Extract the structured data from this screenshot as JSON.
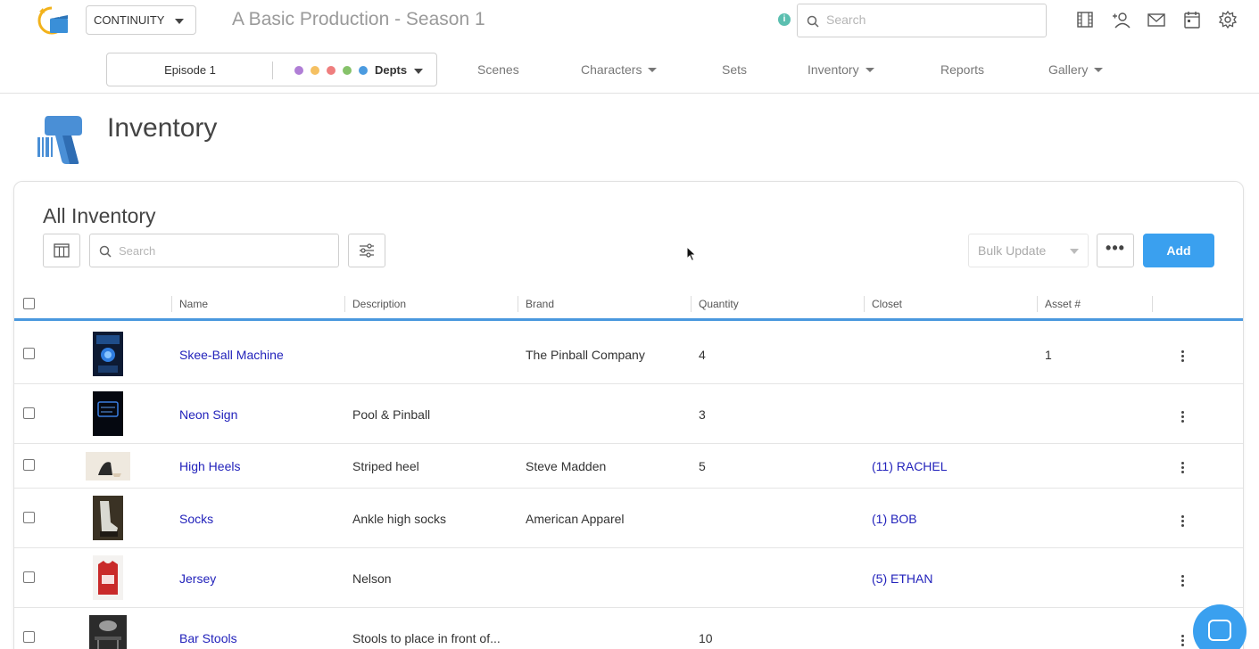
{
  "app": {
    "module_select": "CONTINUITY",
    "production_title": "A Basic Production - Season 1",
    "top_search_placeholder": "Search",
    "colors": {
      "accent": "#3aa0ef",
      "link": "#2222bb",
      "info": "#5bbfb0"
    }
  },
  "top_icons": [
    "film-icon",
    "add-user-icon",
    "mail-icon",
    "calendar-icon",
    "gear-icon"
  ],
  "subnav": {
    "episode": "Episode 1",
    "depts_label": "Depts",
    "dept_colors": [
      "#b07ed6",
      "#f5c062",
      "#ef7e7e",
      "#86c26a",
      "#4b9be0"
    ],
    "items": [
      {
        "label": "Scenes",
        "dropdown": false
      },
      {
        "label": "Characters",
        "dropdown": true
      },
      {
        "label": "Sets",
        "dropdown": false
      },
      {
        "label": "Inventory",
        "dropdown": true
      },
      {
        "label": "Reports",
        "dropdown": false
      },
      {
        "label": "Gallery",
        "dropdown": true
      }
    ]
  },
  "page": {
    "title": "Inventory"
  },
  "card": {
    "title": "All Inventory",
    "search_placeholder": "Search",
    "bulk_update_label": "Bulk Update",
    "more_label": "•••",
    "add_label": "Add"
  },
  "table": {
    "columns": [
      "Name",
      "Description",
      "Brand",
      "Quantity",
      "Closet",
      "Asset #"
    ],
    "rows": [
      {
        "name": "Skee-Ball Machine",
        "description": "",
        "brand": "The Pinball Company",
        "quantity": "4",
        "closet": "",
        "asset": "1",
        "thumb": "skee-ball"
      },
      {
        "name": "Neon Sign",
        "description": "Pool & Pinball",
        "brand": "",
        "quantity": "3",
        "closet": "",
        "asset": "",
        "thumb": "neon"
      },
      {
        "name": "High Heels",
        "description": "Striped heel",
        "brand": "Steve Madden",
        "quantity": "5",
        "closet": "(11) RACHEL",
        "asset": "",
        "thumb": "heels"
      },
      {
        "name": "Socks",
        "description": "Ankle high socks",
        "brand": "American Apparel",
        "quantity": "",
        "closet": "(1) BOB",
        "asset": "",
        "thumb": "socks"
      },
      {
        "name": "Jersey",
        "description": "Nelson",
        "brand": "",
        "quantity": "",
        "closet": "(5) ETHAN",
        "asset": "",
        "thumb": "jersey"
      },
      {
        "name": "Bar Stools",
        "description": "Stools to place in front of...",
        "brand": "",
        "quantity": "10",
        "closet": "",
        "asset": "",
        "thumb": "stools"
      }
    ]
  }
}
